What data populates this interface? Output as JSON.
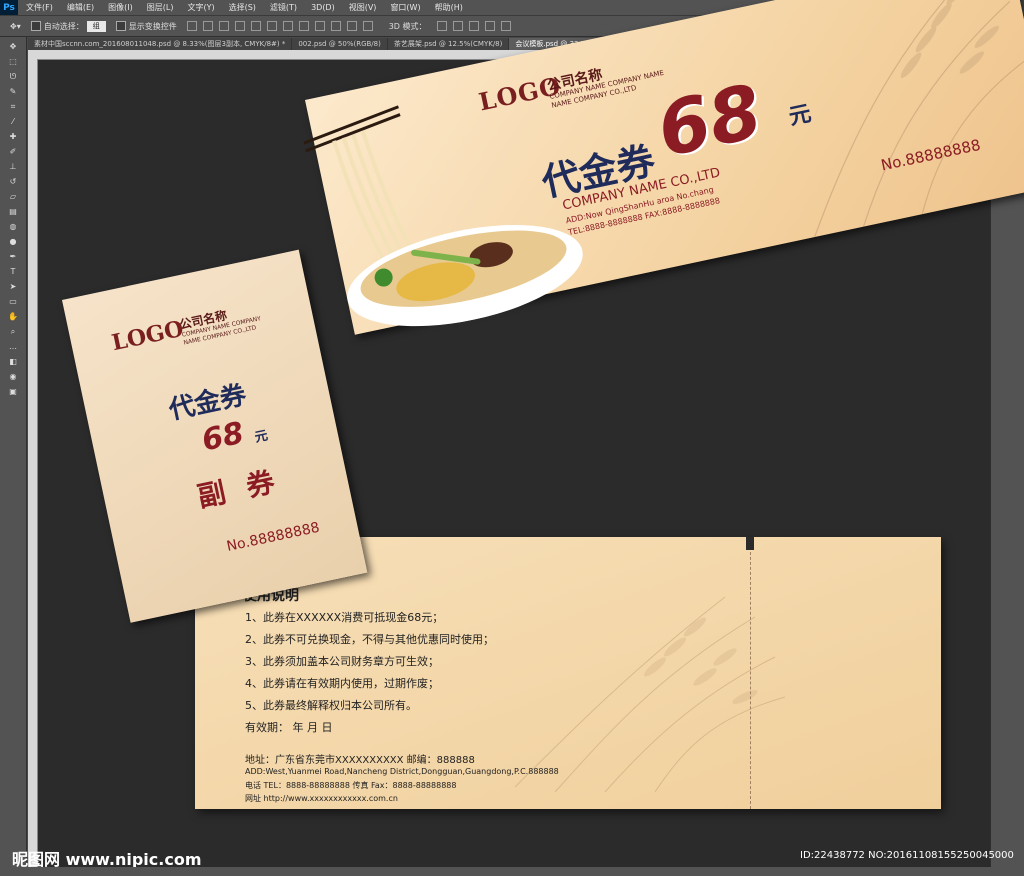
{
  "app": {
    "logo": "Ps",
    "menu": [
      "文件(F)",
      "编辑(E)",
      "图像(I)",
      "图层(L)",
      "文字(Y)",
      "选择(S)",
      "滤镜(T)",
      "3D(D)",
      "视图(V)",
      "窗口(W)",
      "帮助(H)"
    ]
  },
  "options": {
    "auto_select_label": "自动选择：",
    "auto_select_value": "组",
    "show_transform_label": "显示变换控件",
    "mode_label": "3D 模式："
  },
  "tabs": [
    "素材中国sccnn.com_201608011048.psd @ 8.33%(图层3副本, CMYK/8#) *",
    "002.psd @ 50%(RGB/8)",
    "茶艺展架.psd @ 12.5%(CMYK/8)",
    "会议模板.psd @ 33.3%(RGB/8) *"
  ],
  "ticket": {
    "logo": "LOGO",
    "company_cn": "公司名称",
    "company_en_line1": "COMPANY NAME COMPANY NAME",
    "company_en_line2": "NAME COMPANY CO.,LTD",
    "voucher_cn": "代金券",
    "amount": "68",
    "currency": "元",
    "company_en": "COMPANY NAME CO.,LTD",
    "add_line": "ADD:Now QingShanHu aroa No.chang",
    "tel_line": "TEL:8888-8888888   FAX:8888-8888888",
    "serial": "No.88888888"
  },
  "stub": {
    "logo": "LOGO",
    "company_cn": "公司名称",
    "company_en_line1": "COMPANY NAME COMPANY",
    "company_en_line2": "NAME COMPANY CO.,LTD",
    "voucher_cn": "代金券",
    "amount": "68",
    "currency": "元",
    "stub_label": "副 券",
    "serial": "No.88888888"
  },
  "back": {
    "heading": "使用说明",
    "rules": [
      "1、此券在XXXXXX消费可抵现金68元；",
      "2、此券不可兑换现金，不得与其他优惠同时使用；",
      "3、此券须加盖本公司财务章方可生效；",
      "4、此券请在有效期内使用，过期作废；",
      "5、此券最终解释权归本公司所有。"
    ],
    "validity": "有效期：      年    月    日",
    "address_cn": "地址：广东省东莞市XXXXXXXXXX      邮编：888888",
    "address_en": "ADD:West,Yuanmei Road,Nancheng District,Dongguan,Guangdong,P.C.888888",
    "tel_fax": "电话 TEL：8888-88888888     传真 Fax：8888-88888888",
    "website": "网址 http://www.xxxxxxxxxxxx.com.cn"
  },
  "footer": {
    "site": "昵图网 www.nipic.com",
    "id": "ID:22438772 NO:20161108155250045000"
  },
  "colors": {
    "maroon": "#8b1c24",
    "navy": "#1f2b5a",
    "ticket_bg": "#f4d3a2"
  }
}
